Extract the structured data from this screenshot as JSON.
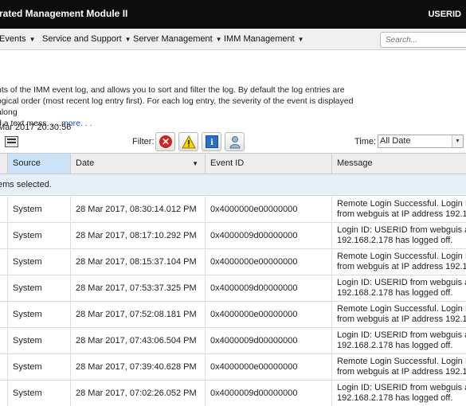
{
  "header": {
    "title": "rated Management Module II",
    "user": "USERID"
  },
  "nav": {
    "items": [
      {
        "label": "Events"
      },
      {
        "label": "Service and Support"
      },
      {
        "label": "Server Management"
      },
      {
        "label": "IMM Management"
      }
    ],
    "search_placeholder": "Search..."
  },
  "description": {
    "line1": "nts of the IMM event log, and allows you to sort and filter the log. By default the log entries are",
    "line2": "ogical order (most recent log entry first). For each log entry, the severity of the event is displayed along",
    "line3": "d a text mess. . .",
    "more_link": "more. . ."
  },
  "timestamp": "Mar 2017 20:30:56",
  "toolbar": {
    "filter_label": "Filter:",
    "time_label": "Time:",
    "time_value": "All Date",
    "icons": [
      "column-settings-icon",
      "error-icon",
      "warning-icon",
      "info-icon",
      "audit-icon"
    ]
  },
  "table": {
    "columns": [
      "Source",
      "Date",
      "Event ID",
      "Message"
    ],
    "sorted_column": "Source",
    "selected_text": "ems selected.",
    "rows": [
      {
        "source": "System",
        "date": "28 Mar 2017, 08:30:14.012 PM",
        "event_id": "0x4000000e00000000",
        "msg1": "Remote Login Successful. Login ID",
        "msg2": "from webguis at IP address 192.1"
      },
      {
        "source": "System",
        "date": "28 Mar 2017, 08:17:10.292 PM",
        "event_id": "0x4000009d00000000",
        "msg1": "Login ID: USERID from webguis at",
        "msg2": "192.168.2.178 has logged off."
      },
      {
        "source": "System",
        "date": "28 Mar 2017, 08:15:37.104 PM",
        "event_id": "0x4000000e00000000",
        "msg1": "Remote Login Successful. Login ID",
        "msg2": "from webguis at IP address 192.1"
      },
      {
        "source": "System",
        "date": "28 Mar 2017, 07:53:37.325 PM",
        "event_id": "0x4000009d00000000",
        "msg1": "Login ID: USERID from webguis at",
        "msg2": "192.168.2.178 has logged off."
      },
      {
        "source": "System",
        "date": "28 Mar 2017, 07:52:08.181 PM",
        "event_id": "0x4000000e00000000",
        "msg1": "Remote Login Successful. Login ID",
        "msg2": "from webguis at IP address 192.1"
      },
      {
        "source": "System",
        "date": "28 Mar 2017, 07:43:06.504 PM",
        "event_id": "0x4000009d00000000",
        "msg1": "Login ID: USERID from webguis at",
        "msg2": "192.168.2.178 has logged off."
      },
      {
        "source": "System",
        "date": "28 Mar 2017, 07:39:40.628 PM",
        "event_id": "0x4000000e00000000",
        "msg1": "Remote Login Successful. Login ID",
        "msg2": "from webguis at IP address 192.1"
      },
      {
        "source": "System",
        "date": "28 Mar 2017, 07:02:26.052 PM",
        "event_id": "0x4000009d00000000",
        "msg1": "Login ID: USERID from webguis at",
        "msg2": "192.168.2.178 has logged off."
      }
    ]
  },
  "colors": {
    "titlebar": "#0d0d0d",
    "sorted_header": "#cbe2f7",
    "selected_bar": "#e7f0f8",
    "link": "#1a44c7",
    "error": "#d52020",
    "warning": "#f5d400",
    "info": "#2a6fc4"
  }
}
